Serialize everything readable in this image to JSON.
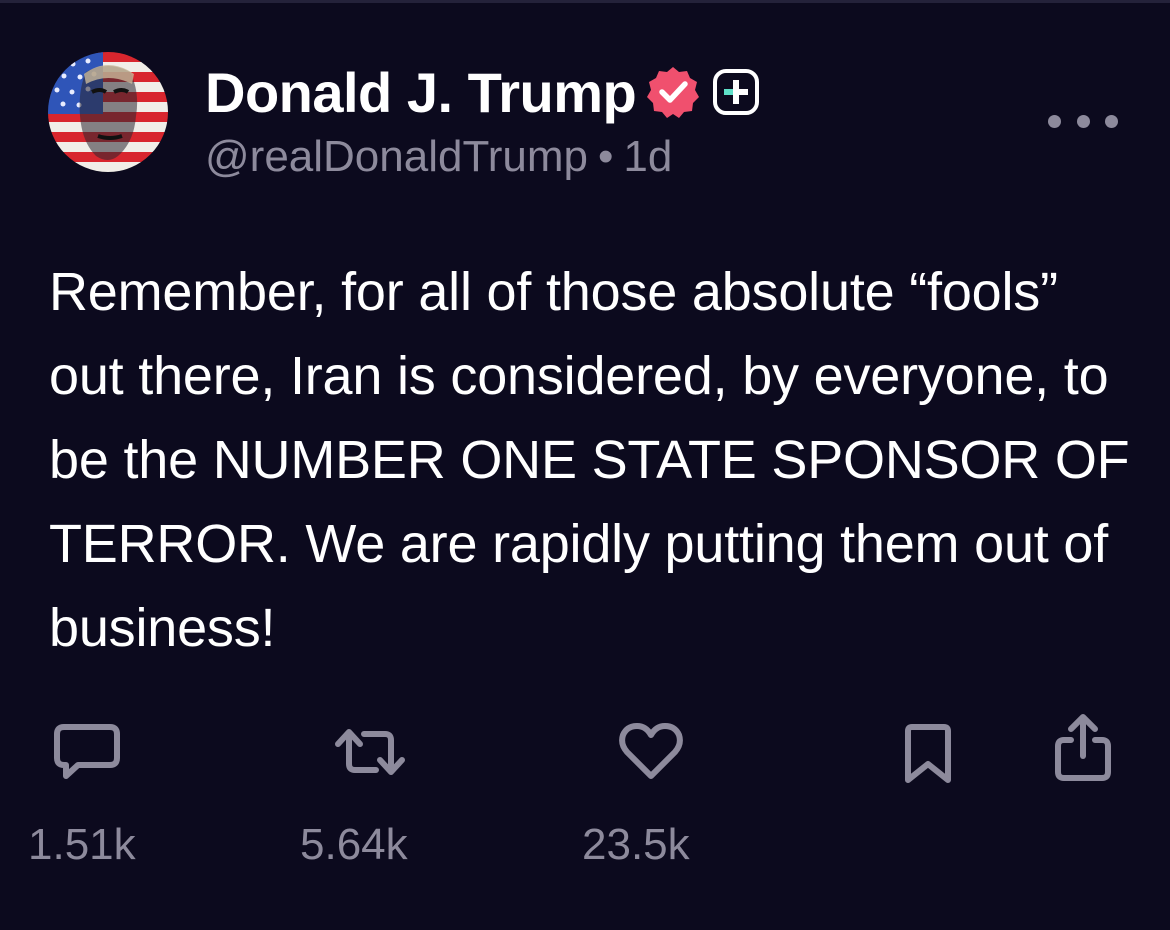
{
  "post": {
    "author": {
      "display_name": "Donald J. Trump",
      "handle": "@realDonaldTrump",
      "avatar_icon": "flag-portrait-avatar",
      "verified_icon": "verified-badge-icon",
      "plus_icon": "plus-badge-icon"
    },
    "separator": "•",
    "time_ago": "1d",
    "body": "Remember, for all of those absolute “fools” out there, Iran is considered, by everyone, to be the NUMBER ONE STATE SPONSOR OF TERROR. We are rapidly putting them out of business!",
    "actions": {
      "reply": {
        "icon": "comment-icon",
        "count": "1.51k"
      },
      "repost": {
        "icon": "repost-icon",
        "count": "5.64k"
      },
      "like": {
        "icon": "heart-icon",
        "count": "23.5k"
      },
      "bookmark": {
        "icon": "bookmark-icon"
      },
      "share": {
        "icon": "share-icon"
      }
    }
  },
  "colors": {
    "background": "#0c0a1e",
    "text_primary": "#ffffff",
    "text_secondary": "#8d8a9c",
    "verified": "#f0506e",
    "plus_accent": "#5fe0c8"
  }
}
